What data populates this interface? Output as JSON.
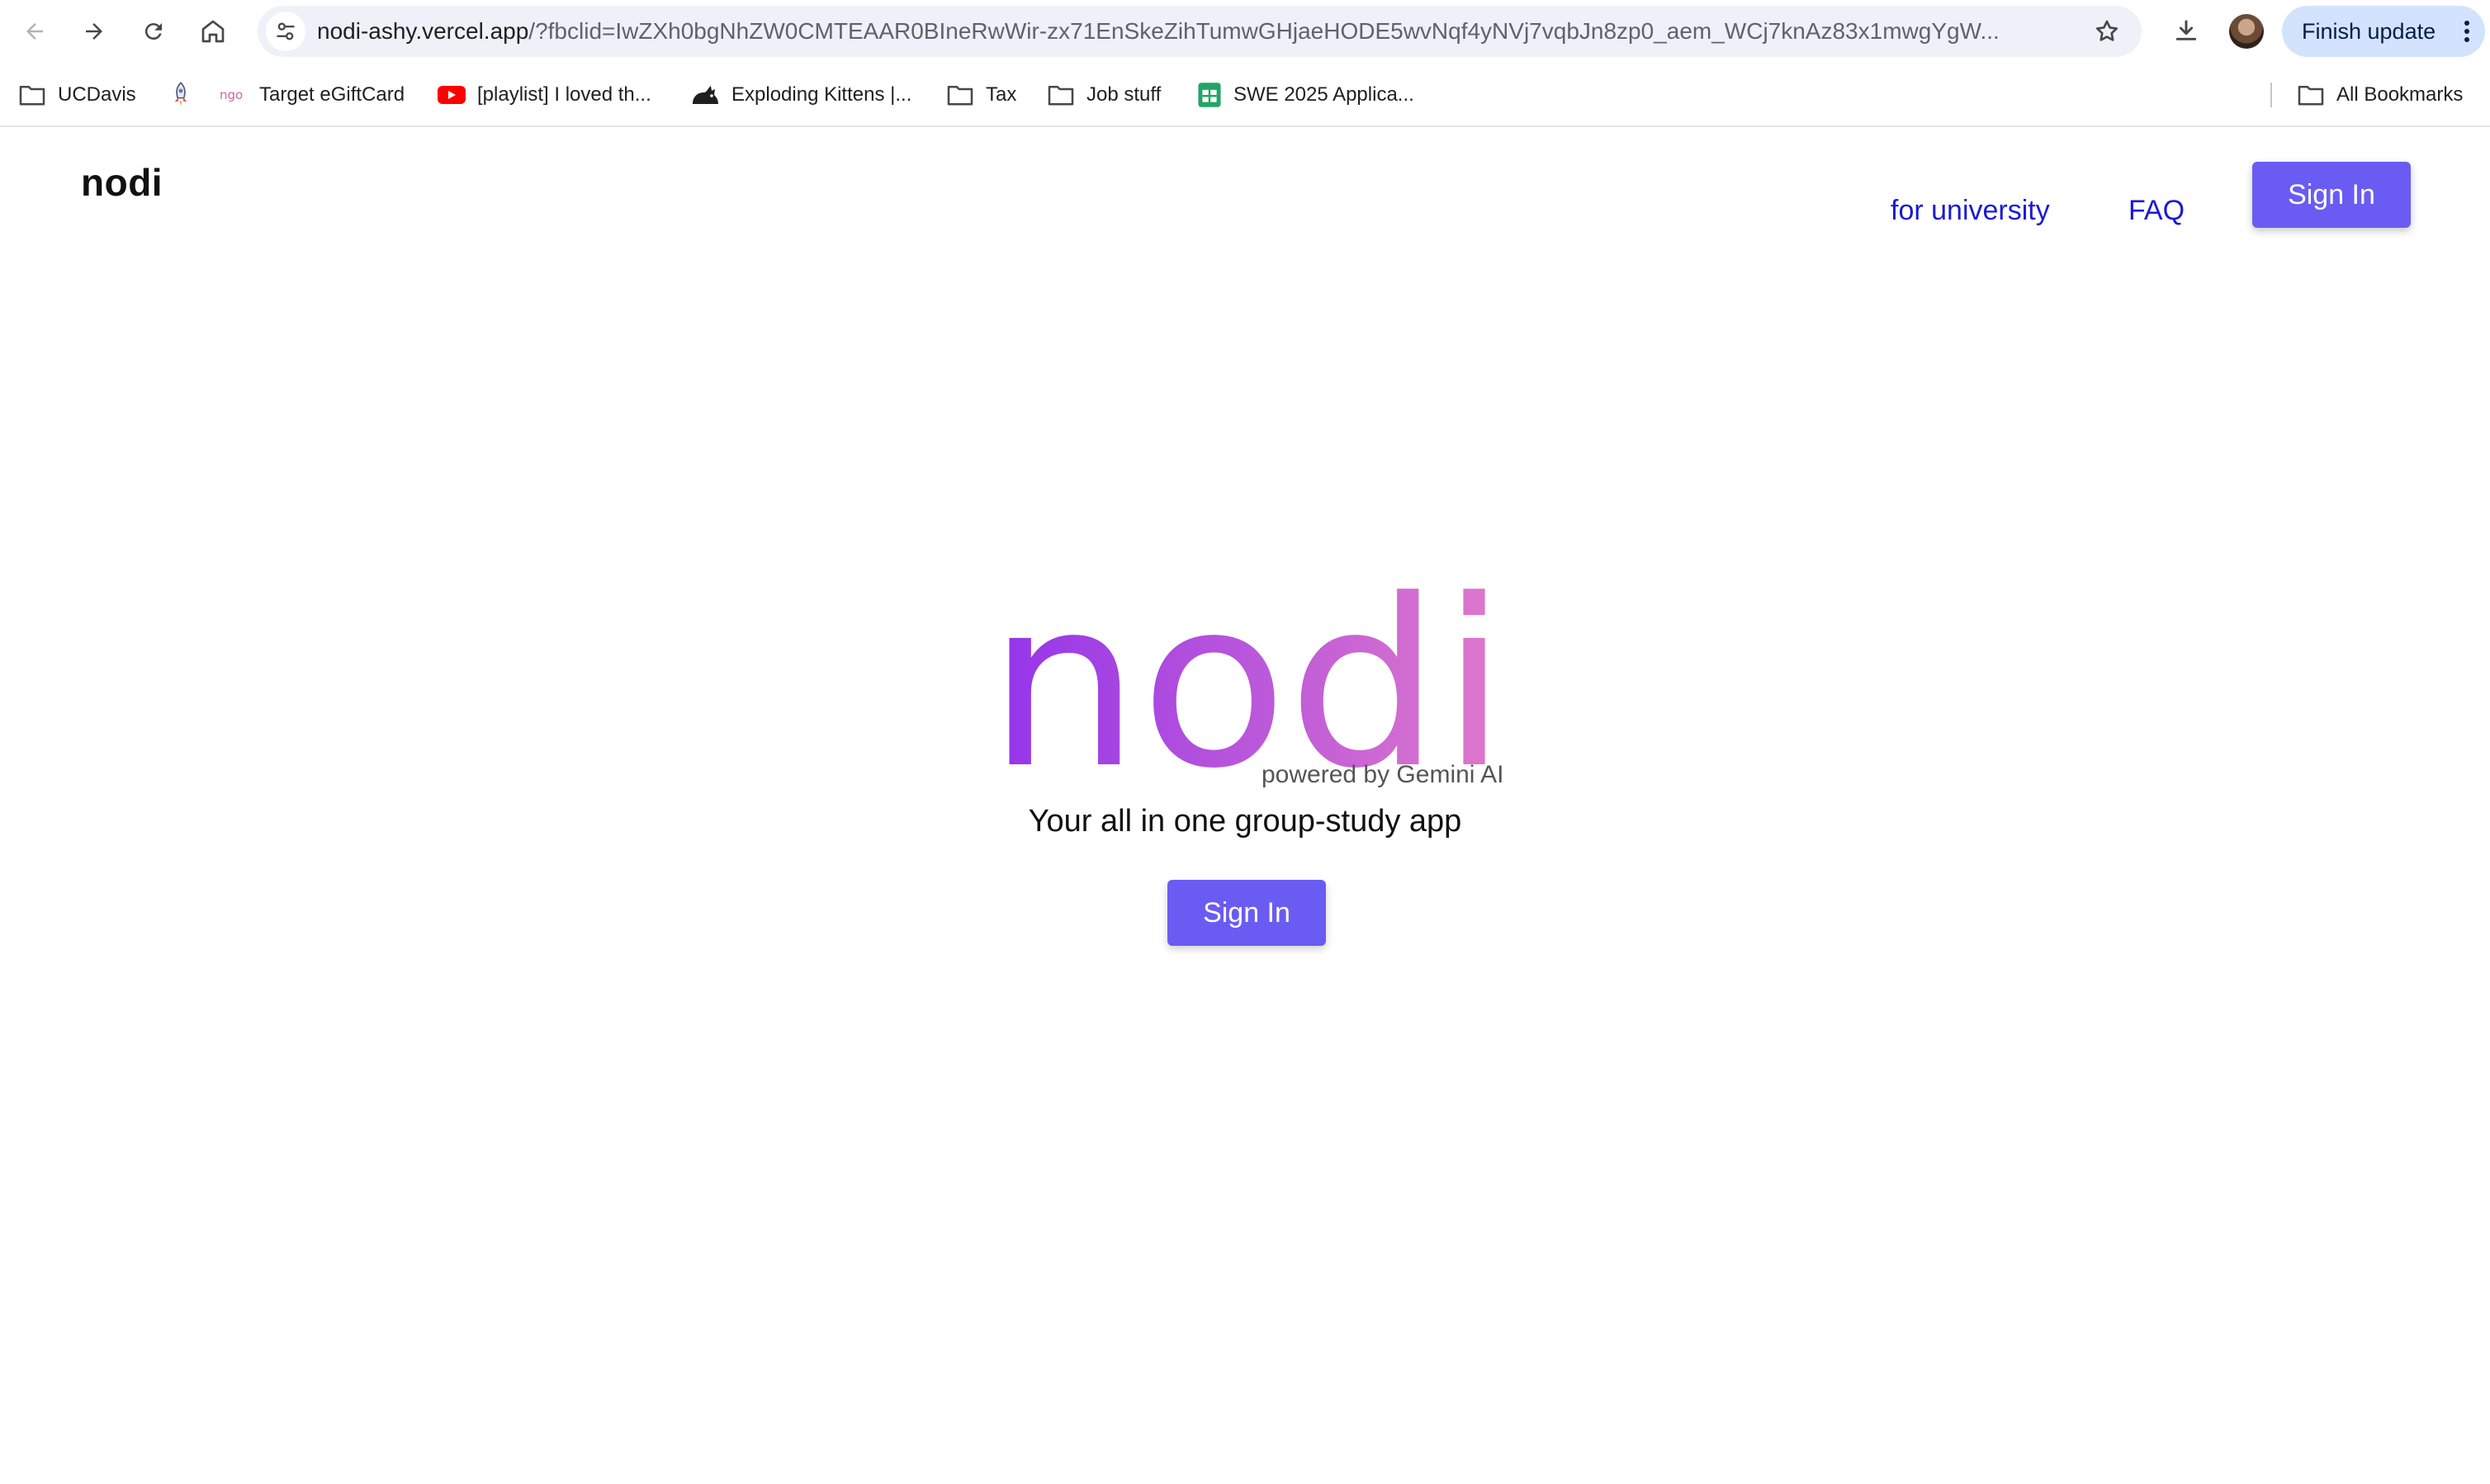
{
  "browser": {
    "url_host": "nodi-ashy.vercel.app",
    "url_rest": "/?fbclid=IwZXh0bgNhZW0CMTEAAR0BIneRwWir-zx71EnSkeZihTumwGHjaeHODE5wvNqf4yNVj7vqbJn8zp0_aem_WCj7knAz83x1mwgYgW...",
    "update_label": "Finish update",
    "icons": {
      "back": "arrow-left-icon",
      "forward": "arrow-right-icon",
      "reload": "reload-icon",
      "home": "home-icon",
      "site_info": "tune-icon",
      "bookmark": "star-icon",
      "downloads": "download-icon",
      "menu": "kebab-icon"
    }
  },
  "bookmarks": {
    "items": [
      {
        "label": "UCDavis",
        "icon": "folder-icon"
      },
      {
        "label": "",
        "icon": "rocket-icon"
      },
      {
        "label": "Target eGiftCard",
        "icon": "ngo-icon"
      },
      {
        "label": "[playlist] I loved th...",
        "icon": "youtube-icon"
      },
      {
        "label": "Exploding Kittens |...",
        "icon": "kitten-icon"
      },
      {
        "label": "Tax",
        "icon": "folder-icon"
      },
      {
        "label": "Job stuff",
        "icon": "folder-icon"
      },
      {
        "label": "SWE 2025 Applica...",
        "icon": "sheets-icon"
      }
    ],
    "all_label": "All Bookmarks"
  },
  "page": {
    "brand": "nodi",
    "nav": {
      "for_university": "for university",
      "faq": "FAQ",
      "sign_in": "Sign In"
    },
    "hero": {
      "logo_text": "nodi",
      "powered_by": "powered by Gemini AI",
      "tagline": "Your all in one group-study app",
      "sign_in": "Sign In"
    }
  },
  "colors": {
    "accent": "#6a5cf2",
    "link": "#1a1ad6",
    "logo_gradient_start": "#9333ea",
    "logo_gradient_end": "#e07acb",
    "update_chip": "#d3e3fd"
  }
}
